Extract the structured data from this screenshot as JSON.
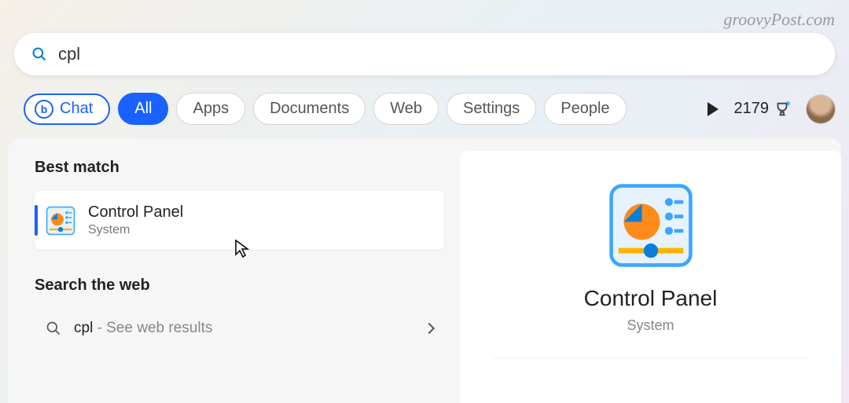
{
  "watermark": "groovyPost.com",
  "search": {
    "value": "cpl"
  },
  "chat": {
    "label": "Chat"
  },
  "filters": [
    {
      "label": "All",
      "active": true
    },
    {
      "label": "Apps",
      "active": false
    },
    {
      "label": "Documents",
      "active": false
    },
    {
      "label": "Web",
      "active": false
    },
    {
      "label": "Settings",
      "active": false
    },
    {
      "label": "People",
      "active": false
    }
  ],
  "points": "2179",
  "sections": {
    "best_match": "Best match",
    "search_web": "Search the web"
  },
  "best_match_item": {
    "title": "Control Panel",
    "subtitle": "System"
  },
  "web_result": {
    "query": "cpl",
    "hint": " - See web results"
  },
  "detail": {
    "title": "Control Panel",
    "subtitle": "System"
  }
}
